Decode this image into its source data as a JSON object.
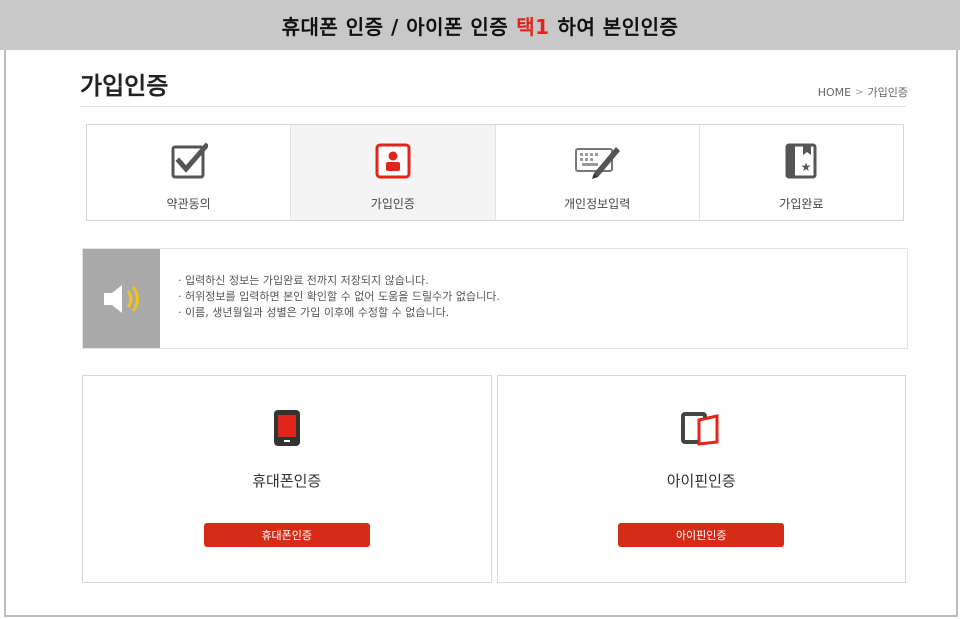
{
  "banner": {
    "prefix": "휴대폰 인증 / 아이폰 인증",
    "accent": "택1",
    "suffix": "하여 본인인증",
    "accent_color": "#e1251b"
  },
  "header": {
    "title": "가입인증",
    "breadcrumb": {
      "home": "HOME",
      "separator": ">",
      "current": "가입인증"
    }
  },
  "steps": [
    {
      "label": "약관동의",
      "icon": "checkbox-icon",
      "active": false
    },
    {
      "label": "가입인증",
      "icon": "user-badge-icon",
      "active": true
    },
    {
      "label": "개인정보입력",
      "icon": "keyboard-pen-icon",
      "active": false
    },
    {
      "label": "가입완료",
      "icon": "bookmark-star-icon",
      "active": false
    }
  ],
  "notice": {
    "icon": "speaker-icon",
    "lines": [
      "입력하신 정보는 가입완료 전까지 저장되지 않습니다.",
      "허위정보를 입력하면 본인 확인할 수 없어 도움을 드릴수가 없습니다.",
      "이름, 생년월일과 성별은 가입 이후에 수정할 수 없습니다."
    ]
  },
  "auth_options": [
    {
      "title": "휴대폰인증",
      "button": "휴대폰인증",
      "icon": "phone-icon"
    },
    {
      "title": "아이핀인증",
      "button": "아이핀인증",
      "icon": "ipin-card-icon"
    }
  ],
  "colors": {
    "accent": "#d42c16",
    "banner_bg": "#c8c8c8",
    "notice_icon_bg": "#a9a9a9"
  }
}
